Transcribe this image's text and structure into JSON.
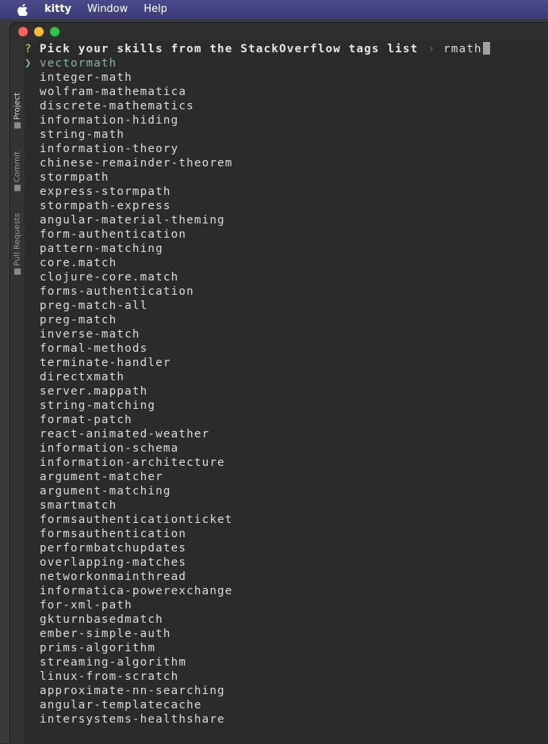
{
  "menubar": {
    "app_name": "kitty",
    "items": [
      "Window",
      "Help"
    ]
  },
  "sidebar": {
    "tabs": [
      {
        "label": "Project",
        "icon": "folder-icon",
        "active": true
      },
      {
        "label": "Commit",
        "icon": "commit-icon",
        "active": false
      },
      {
        "label": "Pull Requests",
        "icon": "pull-request-icon",
        "active": false
      }
    ]
  },
  "prompt": {
    "marker": "?",
    "question": "Pick your skills from the StackOverflow tags list",
    "separator": "›",
    "input_value": "rmath"
  },
  "results": {
    "pointer": "❯",
    "selected_index": 0,
    "items": [
      "vectormath",
      "integer-math",
      "wolfram-mathematica",
      "discrete-mathematics",
      "information-hiding",
      "string-math",
      "information-theory",
      "chinese-remainder-theorem",
      "stormpath",
      "express-stormpath",
      "stormpath-express",
      "angular-material-theming",
      "form-authentication",
      "pattern-matching",
      "core.match",
      "clojure-core.match",
      "forms-authentication",
      "preg-match-all",
      "preg-match",
      "inverse-match",
      "formal-methods",
      "terminate-handler",
      "directxmath",
      "server.mappath",
      "string-matching",
      "format-patch",
      "react-animated-weather",
      "information-schema",
      "information-architecture",
      "argument-matcher",
      "argument-matching",
      "smartmatch",
      "formsauthenticationticket",
      "formsauthentication",
      "performbatchupdates",
      "overlapping-matches",
      "networkonmainthread",
      "informatica-powerexchange",
      "for-xml-path",
      "gkturnbasedmatch",
      "ember-simple-auth",
      "prims-algorithm",
      "streaming-algorithm",
      "linux-from-scratch",
      "approximate-nn-searching",
      "angular-templatecache",
      "intersystems-healthshare"
    ]
  },
  "colors": {
    "menubar": "#3c3c7a",
    "terminal_bg": "#2b2b2b",
    "selected": "#7fb6a8",
    "question_marker": "#9ea860"
  }
}
